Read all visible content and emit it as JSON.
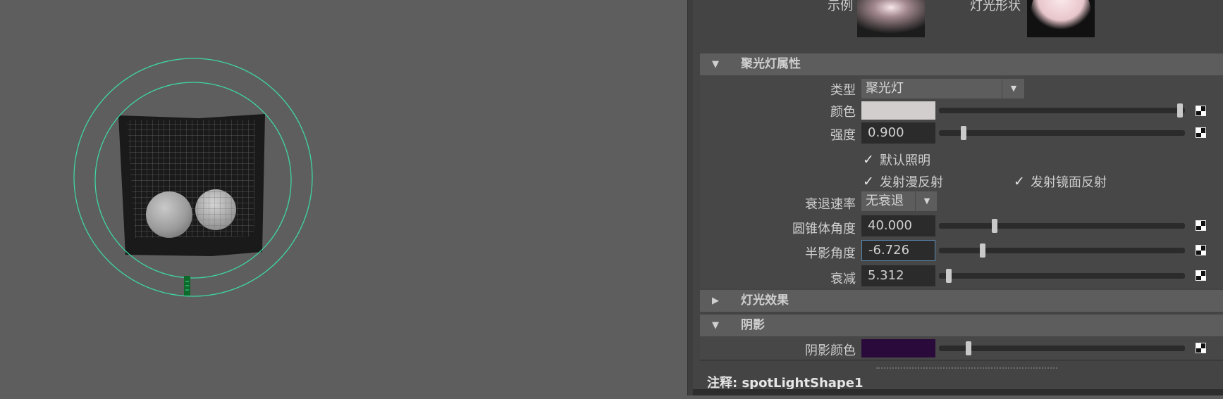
{
  "previews": {
    "sample_label": "示例",
    "light_shape_label": "灯光形状"
  },
  "spot_attrs": {
    "title": "聚光灯属性",
    "expanded": true,
    "type_label": "类型",
    "type_value": "聚光灯",
    "color_label": "颜色",
    "color_value": "#d2cece",
    "color_slider": 0.99,
    "intensity_label": "强度",
    "intensity_value": "0.900",
    "intensity_slider": 0.09,
    "default_lighting_label": "默认照明",
    "default_lighting_checked": true,
    "emit_diffuse_label": "发射漫反射",
    "emit_diffuse_checked": true,
    "emit_specular_label": "发射镜面反射",
    "emit_specular_checked": true,
    "decay_label": "衰退速率",
    "decay_value": "无衰退",
    "cone_angle_label": "圆锥体角度",
    "cone_angle_value": "40.000",
    "cone_angle_slider": 0.22,
    "penumbra_label": "半影角度",
    "penumbra_value": "-6.726",
    "penumbra_slider": 0.17,
    "dropoff_label": "衰减",
    "dropoff_value": "5.312",
    "dropoff_slider": 0.03
  },
  "light_effects": {
    "title": "灯光效果",
    "expanded": false
  },
  "shadows": {
    "title": "阴影",
    "expanded": true,
    "shadow_color_label": "阴影颜色",
    "shadow_color_value": "#2a0a3a",
    "shadow_color_slider": 0.11
  },
  "notes": {
    "text": "注释:  spotLightShape1"
  },
  "icons": {
    "expanded_arrow": "triangle-down-icon",
    "collapsed_arrow": "triangle-right-icon",
    "map_button": "checker-map-icon",
    "dropdown_caret": "chevron-down-icon",
    "checkbox_tick": "check-icon"
  },
  "colors": {
    "viewport_bg": "#5e5e5e",
    "panel_bg": "#444444",
    "section_header_bg": "#5d5d5d",
    "light_manipulator": "#3fd6a0"
  }
}
